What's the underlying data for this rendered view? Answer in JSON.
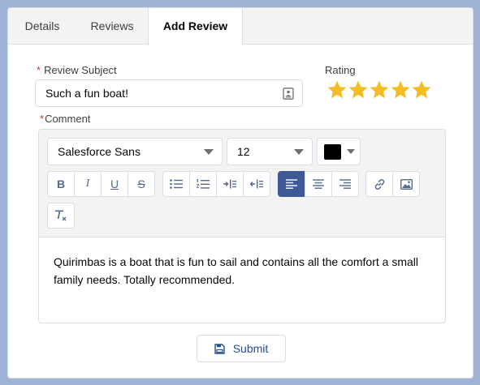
{
  "tabs": [
    {
      "label": "Details"
    },
    {
      "label": "Reviews"
    },
    {
      "label": "Add Review"
    }
  ],
  "form": {
    "required_mark": "*",
    "subject_label": "Review Subject",
    "subject_value": "Such a fun boat!",
    "rating_label": "Rating",
    "rating_value": 5,
    "rating_max": 5,
    "comment_label": "Comment"
  },
  "editor": {
    "font_family": "Salesforce Sans",
    "font_size": "12",
    "text_color": "#000000",
    "format_buttons": {
      "bold": "B",
      "italic": "I",
      "underline": "U",
      "strikethrough": "S"
    },
    "active_alignment": "left",
    "content": "Quirimbas is a boat that is fun to sail and contains all the comfort a small family needs. Totally recommended."
  },
  "submit_label": "Submit",
  "colors": {
    "star": "#f4bc25",
    "active_button": "#3e5a96",
    "required": "#c23934",
    "page_background": "#9fb3d6"
  }
}
